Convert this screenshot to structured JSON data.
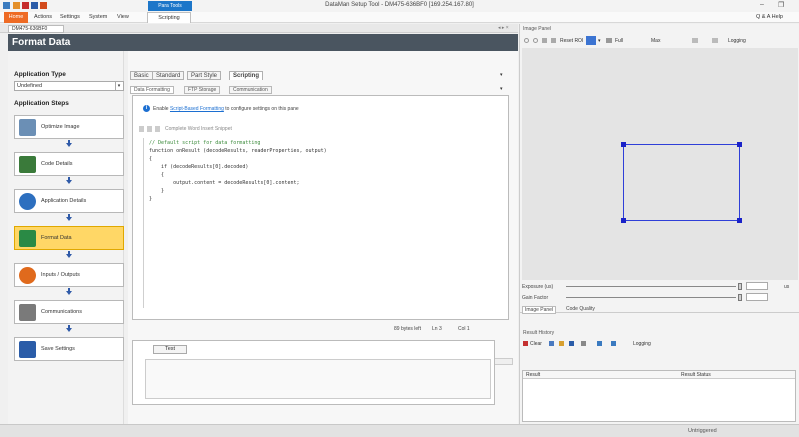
{
  "titlebar": {
    "title": "DataMan Setup Tool - DM475-636BF0 [169.254.167.80]",
    "tools_tab": "Para Tools"
  },
  "menu": {
    "items": [
      "Home",
      "Actions",
      "Settings",
      "System",
      "View",
      "Scripting"
    ]
  },
  "document": {
    "tab_label": "DM475-636BF0",
    "header": "Format Data"
  },
  "left_panel": {
    "application_type_label": "Application Type",
    "application_type_value": "Undefined",
    "application_steps_label": "Application Steps",
    "steps": [
      {
        "label": "Optimize Image",
        "icon": "optimize-image-icon",
        "color": "#6b8fb5"
      },
      {
        "label": "Code Details",
        "icon": "code-details-icon",
        "color": "#3a7a3a"
      },
      {
        "label": "Application Details",
        "icon": "application-details-icon",
        "color": "#2d6fbf"
      },
      {
        "label": "Format Data",
        "icon": "format-data-icon",
        "color": "#2a8a45",
        "active": true
      },
      {
        "label": "Inputs / Outputs",
        "icon": "inputs-outputs-icon",
        "color": "#e06a1c"
      },
      {
        "label": "Communications",
        "icon": "communications-icon",
        "color": "#7a7a7a"
      },
      {
        "label": "Save Settings",
        "icon": "save-settings-icon",
        "color": "#2a5ca8"
      }
    ]
  },
  "format": {
    "tabs": [
      "Basic",
      "Standard",
      "Part Style",
      "Scripting"
    ],
    "subtabs": [
      "Data Formatting",
      "FTP Storage",
      "Communication"
    ],
    "enable_prefix": "Enable",
    "enable_link": "Script-Based Formatting",
    "enable_suffix": "to configure settings on this pane",
    "toolbar_text": "Complete Word   Insert Snippet",
    "code_lines": [
      "// Default script for data formatting",
      "function onResult (decodeResults, readerProperties, output)",
      "{",
      "    if (decodeResults[0].decoded)",
      "    {",
      "        output.content = decodeResults[0].content;",
      "    }",
      "}"
    ],
    "status": {
      "bytes": "89 bytes left",
      "line": "Ln 3",
      "col": "Col 1"
    },
    "test_label": "Test"
  },
  "right_panel": {
    "image_panel_title": "Image Panel",
    "toolbar": {
      "reset_roi": "Reset ROI",
      "full": "Full",
      "zoom": "Max",
      "logging": "Logging"
    },
    "exposure_label": "Exposure (us)",
    "exposure_unit": "us",
    "gain_label": "Gain Factor",
    "subtabs": [
      "Image Panel",
      "Code Quality"
    ],
    "results_title": "Result History",
    "results_toolbar": {
      "clear": "Clear",
      "logging": "Logging"
    },
    "results_columns": [
      "Result",
      "Result Status"
    ]
  },
  "statusbar": {
    "text": "Untriggered"
  },
  "window_controls": {
    "search_help": "Q & A  Help"
  }
}
